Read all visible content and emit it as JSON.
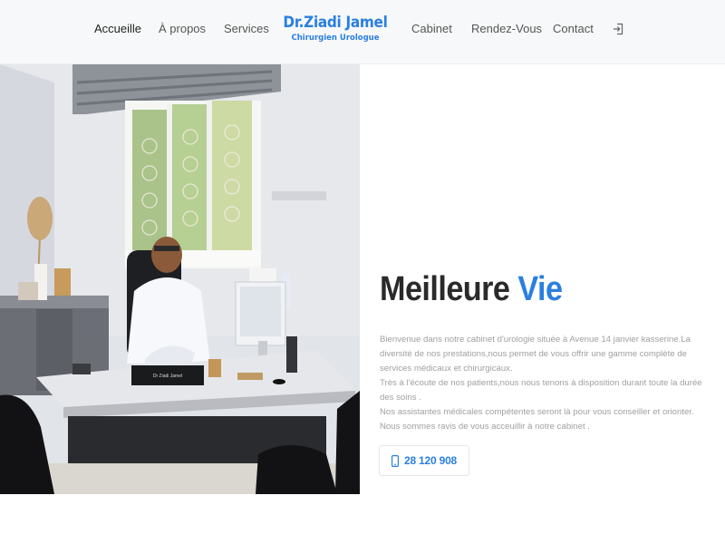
{
  "nav": {
    "items": [
      "Accueille",
      "À propos",
      "Services",
      "Cabinet",
      "Rendez-Vous",
      "Contact"
    ],
    "active": "Accueille",
    "login_icon": "sign-in-icon"
  },
  "brand": {
    "name": "Dr.Ziadi Jamel",
    "subtitle": "Chirurgien Urologue"
  },
  "hero": {
    "title_main": "Meilleure",
    "title_accent": "Vie",
    "paragraphs": [
      "Bienvenue dans notre cabinet d'urologie située à Avenue 14 janvier kasserine.La diversité de nos prestations,nous permet de vous offrir une gamme complète de services médicaux et chirurgicaux.",
      "Très à l'écoute de nos patients,nous nous tenons à disposition durant toute la durée des soins .",
      "Nos assistantes médicales compétentes seront là pour vous conseiller et orionter.",
      "Nous sommes ravis de vous acceuillir à notre cabinet ."
    ],
    "phone": "28 120 908",
    "phone_icon": "mobile-phone-icon",
    "desk_nameplate": "Dr Ziadi Jamel"
  },
  "colors": {
    "accent": "#2a7fe0",
    "header_bg": "#f7f8f9",
    "text_dark": "#2a2a2a",
    "text_muted": "#a0a0a0"
  }
}
